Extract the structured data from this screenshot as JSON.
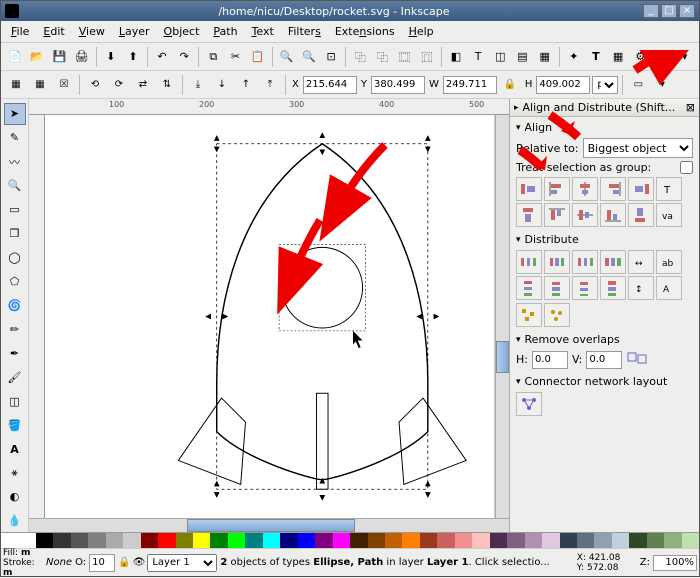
{
  "window": {
    "title": "/home/nicu/Desktop/rocket.svg - Inkscape"
  },
  "menu": {
    "file": "File",
    "edit": "Edit",
    "view": "View",
    "layer": "Layer",
    "object": "Object",
    "path": "Path",
    "text": "Text",
    "filters": "Filters",
    "extensions": "Extensions",
    "help": "Help"
  },
  "coords": {
    "x_label": "X",
    "x_value": "215.644",
    "y_label": "Y",
    "y_value": "380.499",
    "w_label": "W",
    "w_value": "249.711",
    "h_label": "H",
    "h_value": "409.002",
    "unit": "px"
  },
  "ruler": {
    "marks": [
      "100",
      "200",
      "300",
      "400",
      "500"
    ]
  },
  "panel": {
    "title": "Align and Distribute (Shift...",
    "align_section": "Align",
    "relative_label": "Relative to:",
    "relative_value": "Biggest object",
    "treat_group_label": "Treat selection as group:",
    "distribute_section": "Distribute",
    "remove_overlaps": "Remove overlaps",
    "h_label": "H:",
    "h_value": "0.0",
    "v_label": "V:",
    "v_value": "0.0",
    "connector_label": "Connector network layout"
  },
  "status": {
    "fill_label": "Fill:",
    "stroke_label": "Stroke:",
    "fill_value": "m",
    "stroke_value": "m",
    "opacity_label": "O:",
    "opacity_value": "10",
    "layer_name": "Layer 1",
    "message_prefix": "2",
    "message_mid": " objects of types ",
    "message_types": "Ellipse, Path",
    "message_layer_prefix": " in layer ",
    "message_layer": "Layer 1",
    "message_tail": ". Click selectio...",
    "x_label": "X:",
    "x_value": "421.08",
    "y_label": "Y:",
    "y_value": "572.08",
    "zoom_label": "Z:",
    "zoom_value": "100%"
  },
  "palette_colors": [
    "#ffffff",
    "#ffffff",
    "#000000",
    "#333333",
    "#555555",
    "#808080",
    "#aaaaaa",
    "#cccccc",
    "#800000",
    "#ff0000",
    "#808000",
    "#ffff00",
    "#008000",
    "#00ff00",
    "#008080",
    "#00ffff",
    "#000080",
    "#0000ff",
    "#800080",
    "#ff00ff",
    "#402000",
    "#804000",
    "#c06000",
    "#ff8000",
    "#9a3820",
    "#cc6060",
    "#f09090",
    "#ffc0c0",
    "#4a2e4f",
    "#806080",
    "#b090b0",
    "#e0c8e0",
    "#304050",
    "#607080",
    "#90a0b0",
    "#c0d0e0",
    "#304828",
    "#608050",
    "#90b080",
    "#c0e0b0"
  ]
}
